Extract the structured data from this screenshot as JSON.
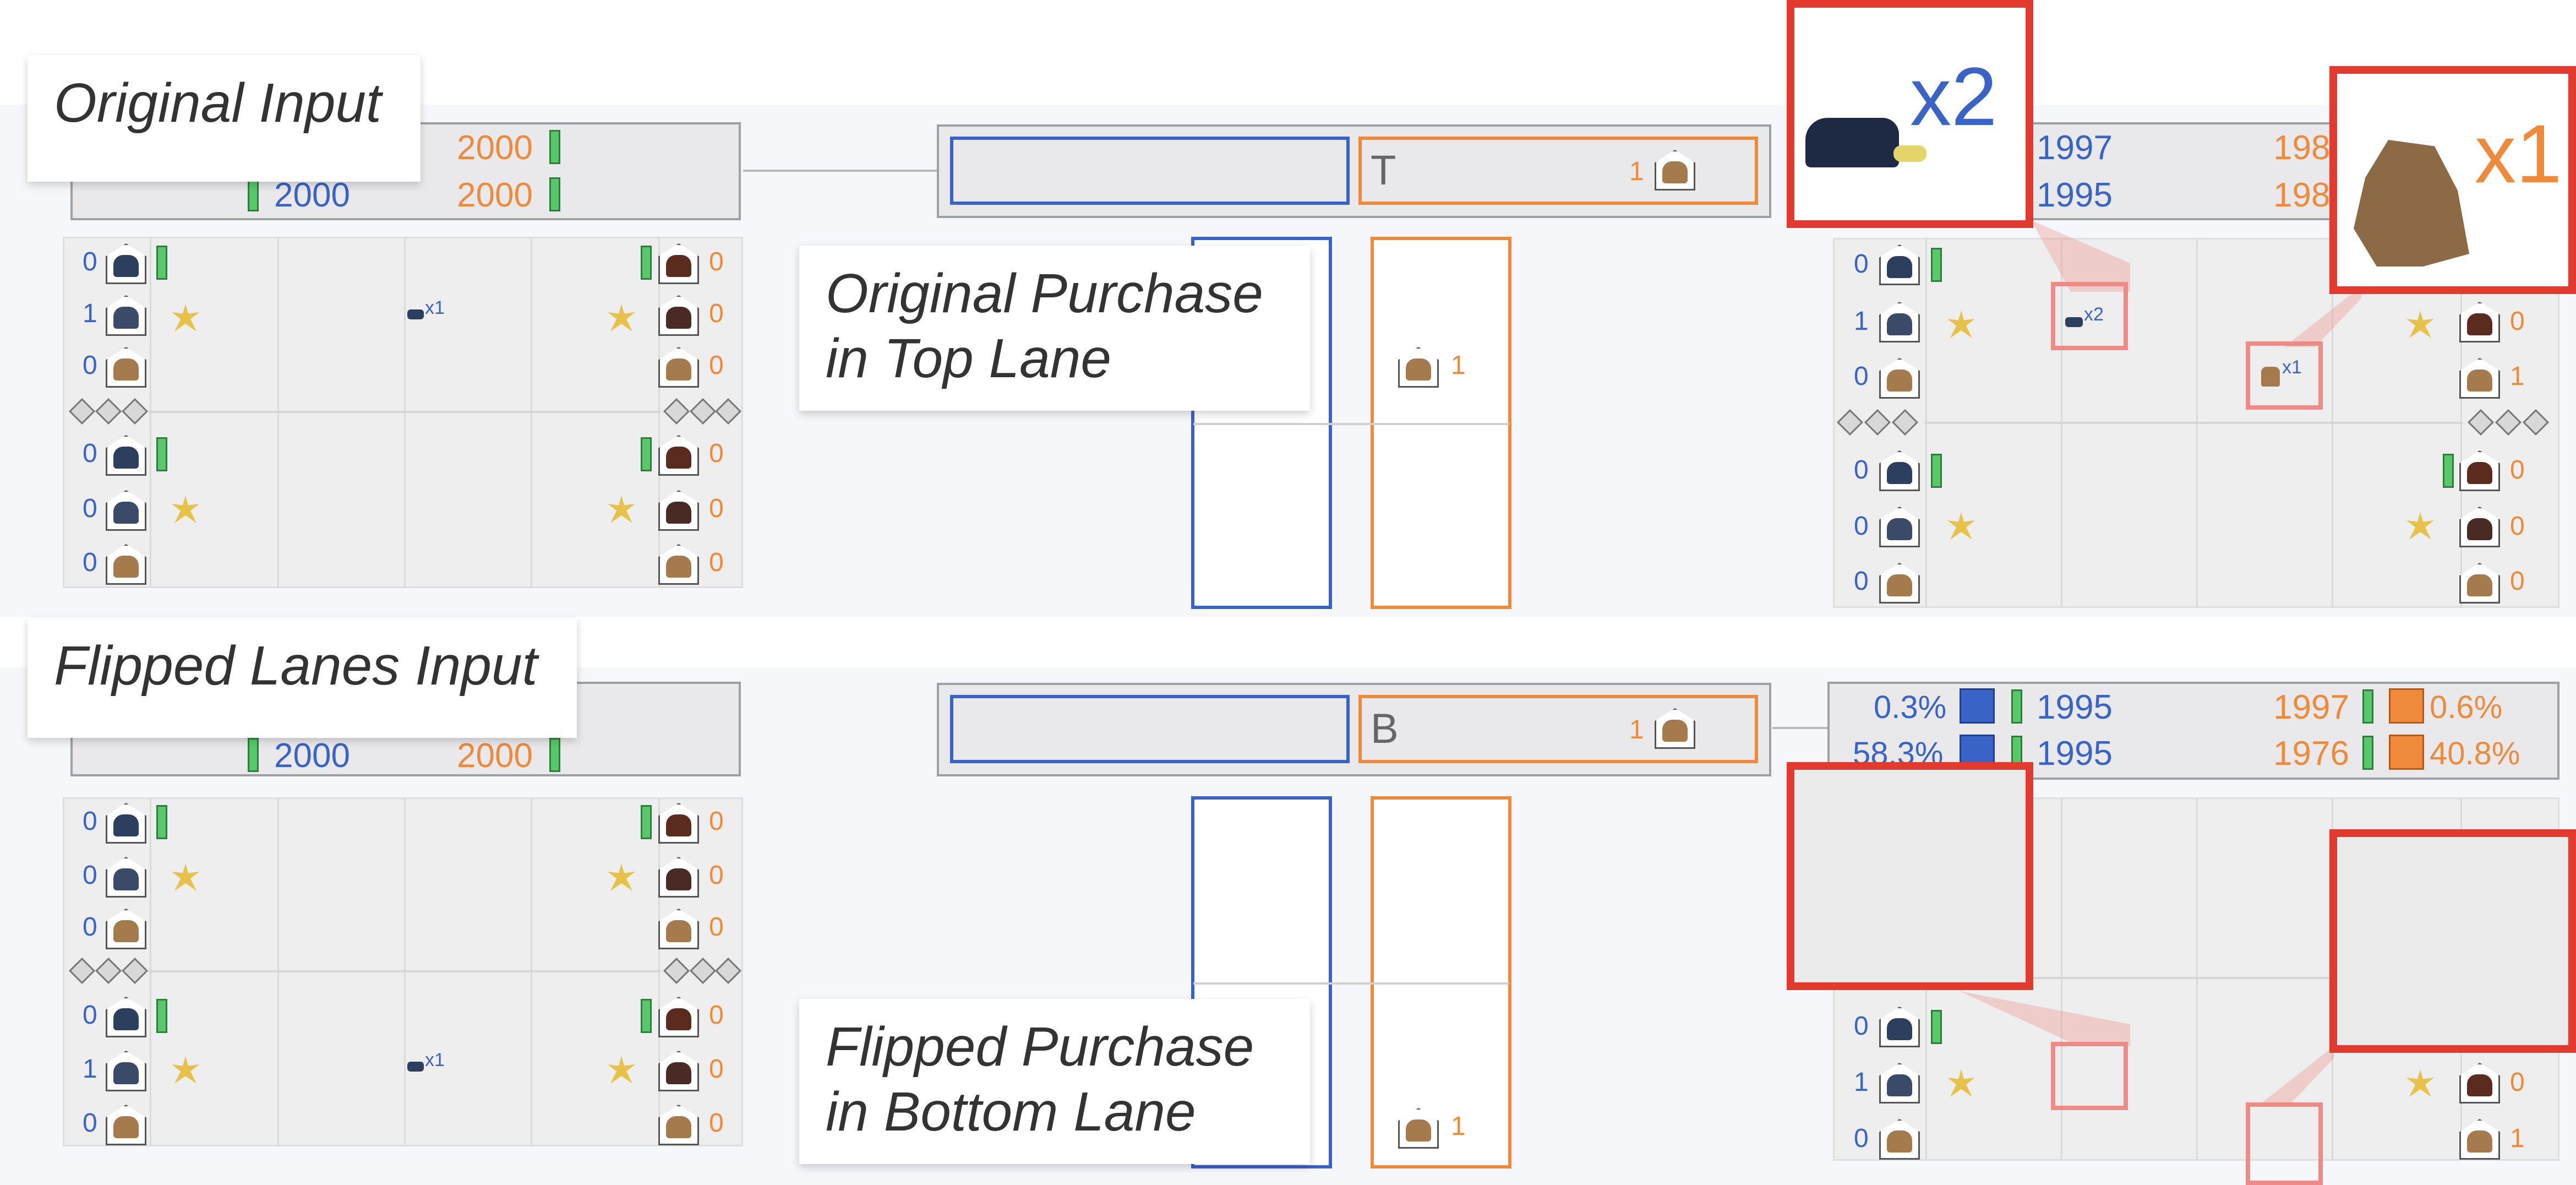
{
  "labels": {
    "original_input": "Original Input",
    "flipped_input": "Flipped Lanes Input",
    "original_purchase_line1": "Original Purchase",
    "original_purchase_line2": "in Top Lane",
    "flipped_purchase_line1": "Flipped Purchase",
    "flipped_purchase_line2": "in Bottom Lane"
  },
  "top": {
    "left_bar": {
      "orange_top": "2000",
      "blue_bottom": "2000",
      "orange_bottom": "2000"
    },
    "action": {
      "lane_letter": "T",
      "count": "1"
    },
    "right_bar": {
      "blue_top": "1997",
      "orange_top": "198",
      "blue_bottom": "1995",
      "orange_bottom": "198"
    },
    "zoom_left": "x2",
    "zoom_right": "x1",
    "slot_count": "1",
    "left_grid": {
      "left_counts": [
        "0",
        "1",
        "0",
        "0",
        "0",
        "0"
      ],
      "right_counts": [
        "0",
        "0",
        "0",
        "0",
        "0",
        "0"
      ],
      "mini_label": "x1"
    },
    "right_grid": {
      "left_counts": [
        "0",
        "1",
        "0",
        "0",
        "0",
        "0"
      ],
      "right_counts": [
        "0",
        "0",
        "1",
        "0",
        "0",
        "0"
      ],
      "mini_a": "x2",
      "mini_b": "x1"
    }
  },
  "bottom": {
    "left_bar": {
      "blue_bottom": "2000",
      "orange_bottom": "2000"
    },
    "action": {
      "lane_letter": "B",
      "count": "1"
    },
    "right_bar": {
      "pct_blue_top": "0.3%",
      "blue_top": "1995",
      "orange_top": "1997",
      "pct_orange_top": "0.6%",
      "pct_blue_bottom": "58.3%",
      "blue_bottom": "1995",
      "orange_bottom": "1976",
      "pct_orange_bottom": "40.8%"
    },
    "slot_count": "1",
    "left_grid": {
      "left_counts": [
        "0",
        "0",
        "0",
        "0",
        "1",
        "0"
      ],
      "right_counts": [
        "0",
        "0",
        "0",
        "0",
        "0",
        "0"
      ],
      "mini_label": "x1"
    },
    "right_grid": {
      "left_counts": [
        "0",
        "1",
        "0"
      ],
      "right_counts": [
        "0",
        "1"
      ]
    }
  },
  "colors": {
    "blue": "#3a63c8",
    "orange": "#ef8a3b",
    "red": "#e23a2e",
    "pink": "#ef8b86",
    "green": "#59c86a"
  }
}
